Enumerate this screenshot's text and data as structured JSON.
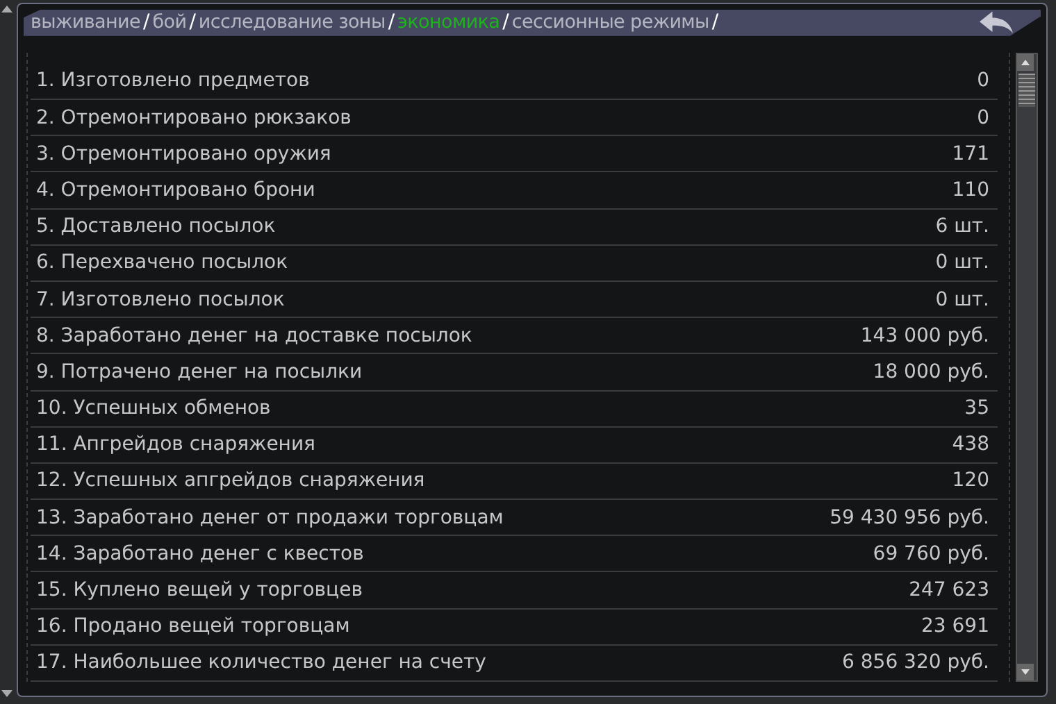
{
  "breadcrumbs": [
    {
      "label": "выживание",
      "separator": "/",
      "selected": false
    },
    {
      "label": "бой",
      "separator": "/",
      "selected": false
    },
    {
      "label": "исследование зоны",
      "separator": "/",
      "selected": false
    },
    {
      "label": "экономика",
      "separator": "/",
      "selected": true
    },
    {
      "label": "сессионные режимы",
      "separator": "/",
      "selected": false
    }
  ],
  "stats": [
    {
      "label": "1. Изготовлено предметов",
      "value": "0"
    },
    {
      "label": "2. Отремонтировано рюкзаков",
      "value": "0"
    },
    {
      "label": "3. Отремонтировано оружия",
      "value": "171"
    },
    {
      "label": "4. Отремонтировано брони",
      "value": "110"
    },
    {
      "label": "5. Доставлено посылок",
      "value": "6 шт."
    },
    {
      "label": "6. Перехвачено посылок",
      "value": "0 шт."
    },
    {
      "label": "7. Изготовлено посылок",
      "value": "0 шт."
    },
    {
      "label": "8. Заработано денег на доставке посылок",
      "value": "143 000 руб."
    },
    {
      "label": "9. Потрачено денег на посылки",
      "value": "18 000 руб."
    },
    {
      "label": "10. Успешных обменов",
      "value": "35"
    },
    {
      "label": "11. Апгрейдов снаряжения",
      "value": "438"
    },
    {
      "label": "12. Успешных апгрейдов снаряжения",
      "value": "120"
    },
    {
      "label": "13. Заработано денег от продажи торговцам",
      "value": "59 430 956 руб."
    },
    {
      "label": "14. Заработано денег с квестов",
      "value": "69 760 руб."
    },
    {
      "label": "15. Куплено вещей у торговцев",
      "value": "247 623"
    },
    {
      "label": "16. Продано вещей торговцам",
      "value": "23 691"
    },
    {
      "label": "17. Наибольшее количество денег на счету",
      "value": "6 856 320 руб."
    }
  ]
}
